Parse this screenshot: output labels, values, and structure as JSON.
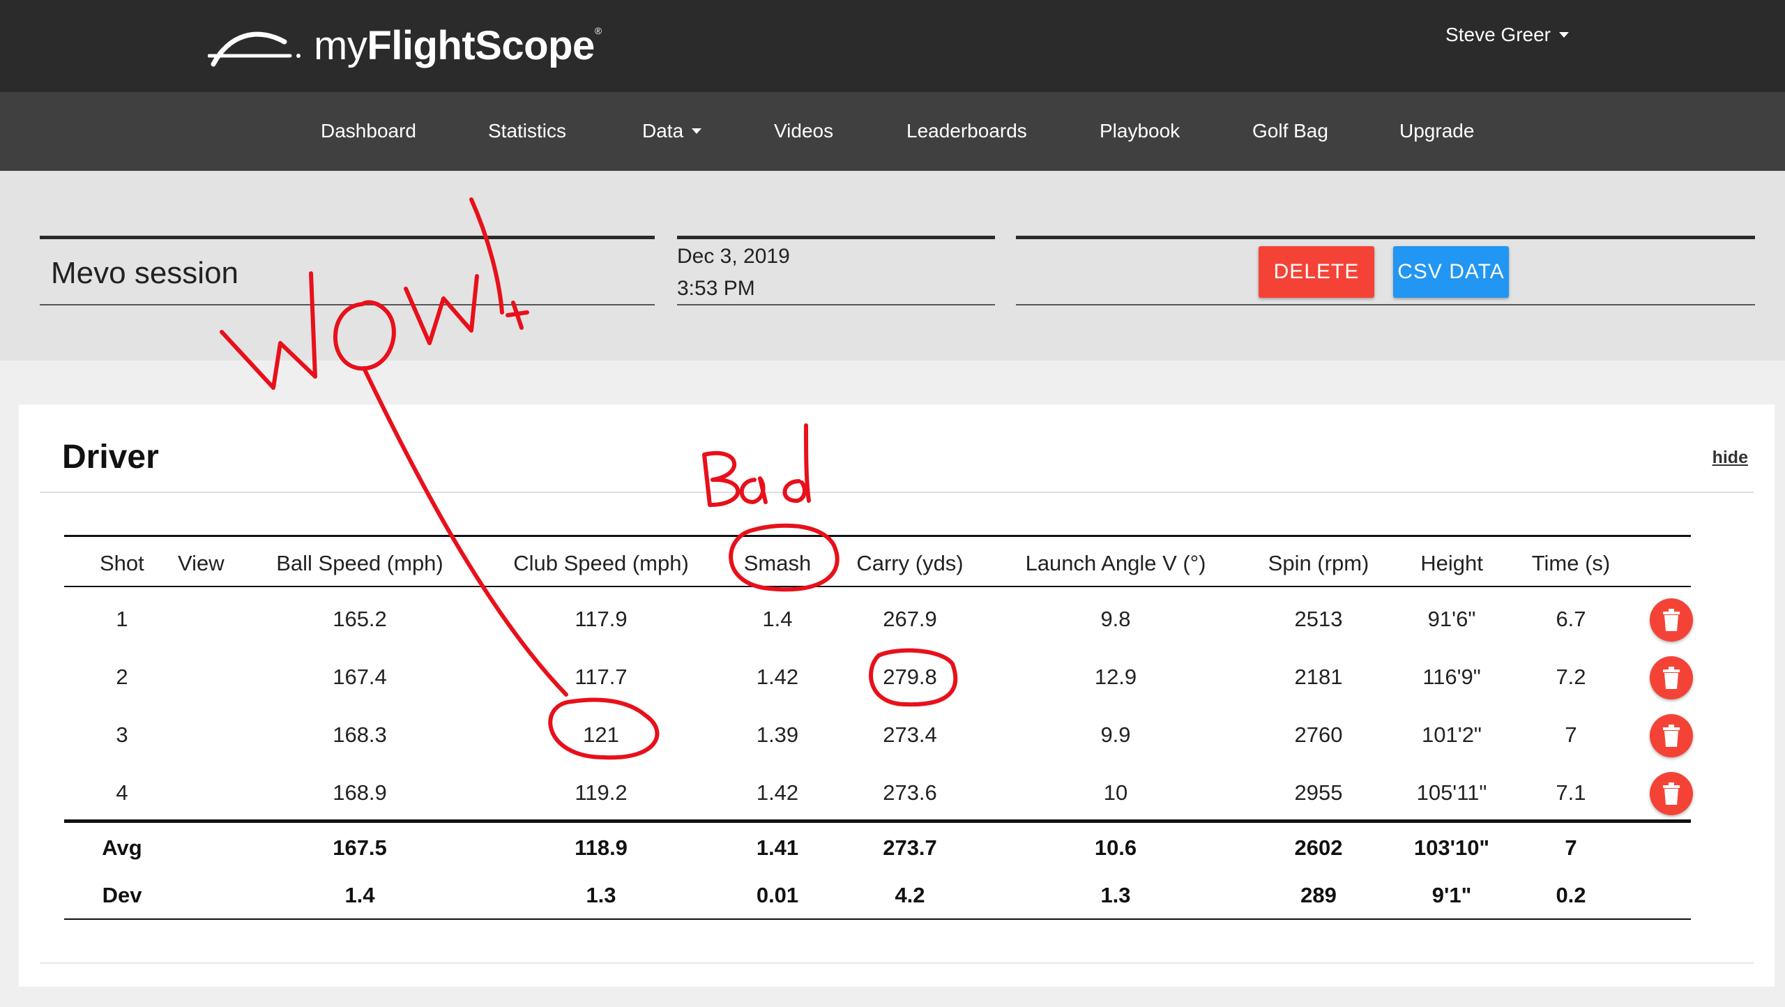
{
  "brand": {
    "prefix": "my",
    "name": "FlightScope",
    "mark": "®"
  },
  "user": {
    "name": "Steve Greer"
  },
  "nav": [
    {
      "label": "Dashboard"
    },
    {
      "label": "Statistics"
    },
    {
      "label": "Data"
    },
    {
      "label": "Videos"
    },
    {
      "label": "Leaderboards"
    },
    {
      "label": "Playbook"
    },
    {
      "label": "Golf Bag"
    },
    {
      "label": "Upgrade"
    }
  ],
  "session": {
    "title": "Mevo session",
    "date": "Dec 3, 2019",
    "time": "3:53 PM",
    "delete_label": "DELETE",
    "csv_label": "CSV DATA"
  },
  "club": {
    "name": "Driver",
    "hide_label": "hide"
  },
  "table": {
    "headers": [
      "Shot",
      "View",
      "Ball Speed (mph)",
      "Club Speed (mph)",
      "Smash",
      "Carry (yds)",
      "Launch Angle V (°)",
      "Spin (rpm)",
      "Height",
      "Time (s)"
    ],
    "rows": [
      [
        "1",
        "165.2",
        "117.9",
        "1.4",
        "267.9",
        "9.8",
        "2513",
        "91'6\"",
        "6.7"
      ],
      [
        "2",
        "167.4",
        "117.7",
        "1.42",
        "279.8",
        "12.9",
        "2181",
        "116'9\"",
        "7.2"
      ],
      [
        "3",
        "168.3",
        "121",
        "1.39",
        "273.4",
        "9.9",
        "2760",
        "101'2\"",
        "7"
      ],
      [
        "4",
        "168.9",
        "119.2",
        "1.42",
        "273.6",
        "10",
        "2955",
        "105'11\"",
        "7.1"
      ]
    ],
    "summary": [
      [
        "Avg",
        "167.5",
        "118.9",
        "1.41",
        "273.7",
        "10.6",
        "2602",
        "103'10\"",
        "7"
      ],
      [
        "Dev",
        "1.4",
        "1.3",
        "0.01",
        "4.2",
        "1.3",
        "289",
        "9'1\"",
        "0.2"
      ]
    ]
  },
  "annotations": {
    "wow": "WOW!",
    "bad": "Bad",
    "color": "#e8101a"
  },
  "colors": {
    "topbar": "#2b2b2b",
    "navbar": "#404040",
    "delete": "#f44336",
    "csv": "#2196f3"
  }
}
